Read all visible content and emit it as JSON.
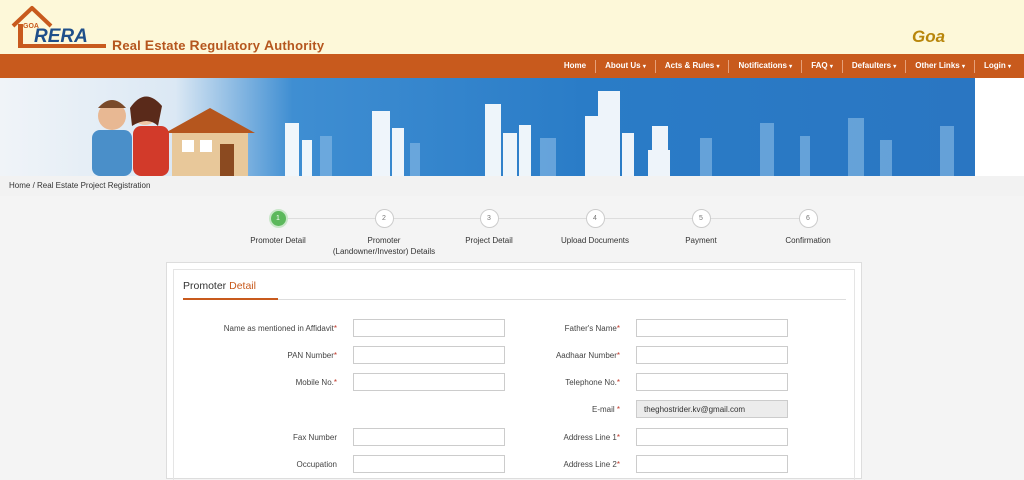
{
  "header": {
    "logo_small": "GOA",
    "logo_text": "RERA",
    "title_parts": [
      {
        "cap": "R",
        "rest": "eal "
      },
      {
        "cap": "E",
        "rest": "state "
      },
      {
        "cap": "R",
        "rest": "egulatory "
      },
      {
        "cap": "A",
        "rest": "uthority"
      }
    ],
    "state": "Goa"
  },
  "nav": {
    "items": [
      {
        "label": "Home",
        "caret": ""
      },
      {
        "label": "About Us",
        "caret": "▾"
      },
      {
        "label": "Acts & Rules",
        "caret": "▾"
      },
      {
        "label": "Notifications",
        "caret": "▾"
      },
      {
        "label": "FAQ",
        "caret": "▾"
      },
      {
        "label": "Defaulters",
        "caret": "▾"
      },
      {
        "label": "Other Links",
        "caret": "▾"
      },
      {
        "label": "Login",
        "caret": "▾"
      }
    ]
  },
  "breadcrumb": "Home / Real Estate Project Registration",
  "steps": [
    {
      "num": "1",
      "line1": "Promoter Detail",
      "line2": "",
      "active": true
    },
    {
      "num": "2",
      "line1": "Promoter",
      "line2": "(Landowner/Investor) Details",
      "active": false
    },
    {
      "num": "3",
      "line1": "Project Detail",
      "line2": "",
      "active": false
    },
    {
      "num": "4",
      "line1": "Upload Documents",
      "line2": "",
      "active": false
    },
    {
      "num": "5",
      "line1": "Payment",
      "line2": "",
      "active": false
    },
    {
      "num": "6",
      "line1": "Confirmation",
      "line2": "",
      "active": false
    }
  ],
  "form": {
    "title_plain": "Promoter ",
    "title_accent": "Detail",
    "required_mark": "*",
    "fields": {
      "affidavit_name": {
        "label": "Name as mentioned in Affidavit",
        "required": true,
        "value": ""
      },
      "father_name": {
        "label": "Father's Name",
        "required": true,
        "value": ""
      },
      "pan": {
        "label": "PAN Number",
        "required": true,
        "value": ""
      },
      "aadhaar": {
        "label": "Aadhaar Number",
        "required": true,
        "value": ""
      },
      "mobile": {
        "label": "Mobile No.",
        "required": true,
        "value": ""
      },
      "telephone": {
        "label": "Telephone No.",
        "required": true,
        "value": ""
      },
      "email": {
        "label": "E-mail ",
        "required": true,
        "value": "theghostrider.kv@gmail.com"
      },
      "fax": {
        "label": "Fax Number",
        "required": false,
        "value": ""
      },
      "address1": {
        "label": "Address Line 1",
        "required": true,
        "value": ""
      },
      "occupation": {
        "label": "Occupation",
        "required": false,
        "value": ""
      },
      "address2": {
        "label": "Address Line 2",
        "required": true,
        "value": ""
      }
    }
  },
  "colors": {
    "brand_orange": "#c85a1d",
    "header_bg": "#fdf8d9",
    "step_active": "#5cb85c",
    "banner_blue": "#2a7cc7"
  }
}
